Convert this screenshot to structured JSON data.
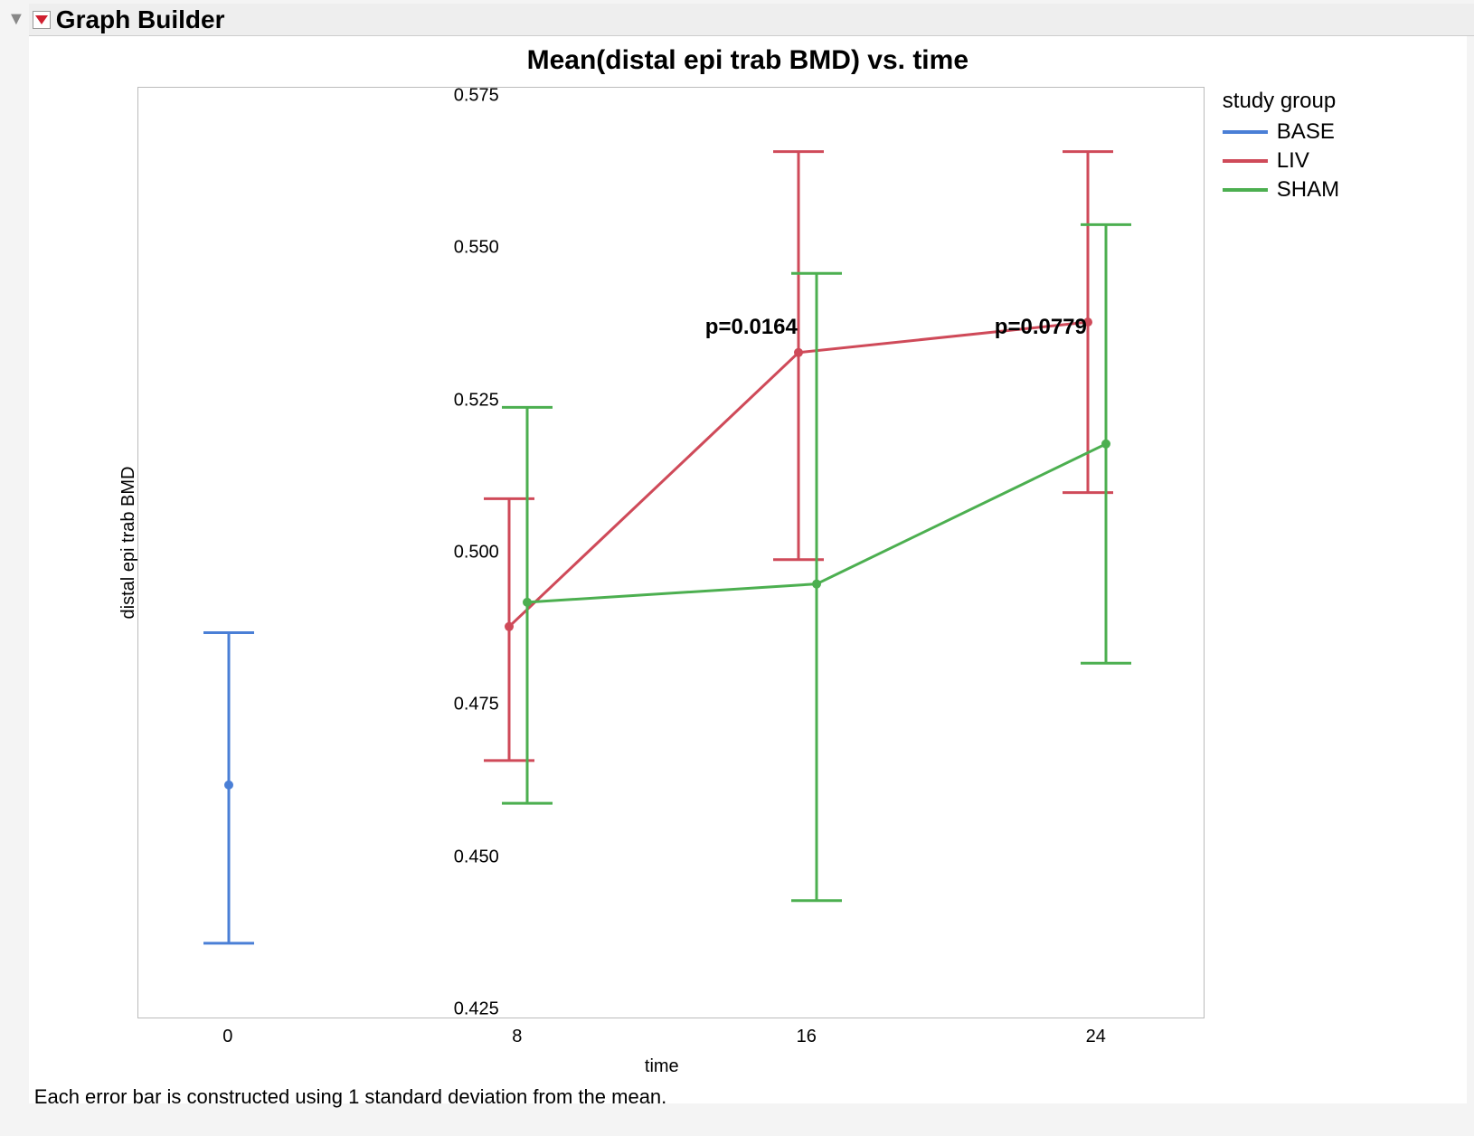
{
  "panel": {
    "title": "Graph Builder"
  },
  "chart_data": {
    "type": "line",
    "title": "Mean(distal epi trab BMD) vs. time",
    "xlabel": "time",
    "ylabel": "distal epi trab BMD",
    "x": [
      0,
      8,
      16,
      24
    ],
    "xticks": [
      "0",
      "8",
      "16",
      "24"
    ],
    "ylim": [
      0.425,
      0.575
    ],
    "yticks": [
      "0.425",
      "0.450",
      "0.475",
      "0.500",
      "0.525",
      "0.550",
      "0.575"
    ],
    "legend_title": "study group",
    "series": [
      {
        "name": "BASE",
        "color": "#4a7fd6",
        "x": [
          0
        ],
        "y": [
          0.462
        ],
        "err_low": [
          0.436
        ],
        "err_high": [
          0.487
        ]
      },
      {
        "name": "LIV",
        "color": "#cf4a59",
        "x": [
          8,
          16,
          24
        ],
        "y": [
          0.488,
          0.533,
          0.538
        ],
        "err_low": [
          0.466,
          0.499,
          0.51
        ],
        "err_high": [
          0.509,
          0.566,
          0.566
        ]
      },
      {
        "name": "SHAM",
        "color": "#4caf50",
        "x": [
          8,
          16,
          24
        ],
        "y": [
          0.492,
          0.495,
          0.518
        ],
        "err_low": [
          0.459,
          0.443,
          0.482
        ],
        "err_high": [
          0.524,
          0.546,
          0.554
        ]
      }
    ],
    "annotations": [
      {
        "text": "p=0.0164",
        "x": 14.7,
        "y": 0.537
      },
      {
        "text": "p=0.0779",
        "x": 22.7,
        "y": 0.537
      }
    ],
    "footnote": "Each error bar is constructed using 1 standard deviation from the mean."
  }
}
